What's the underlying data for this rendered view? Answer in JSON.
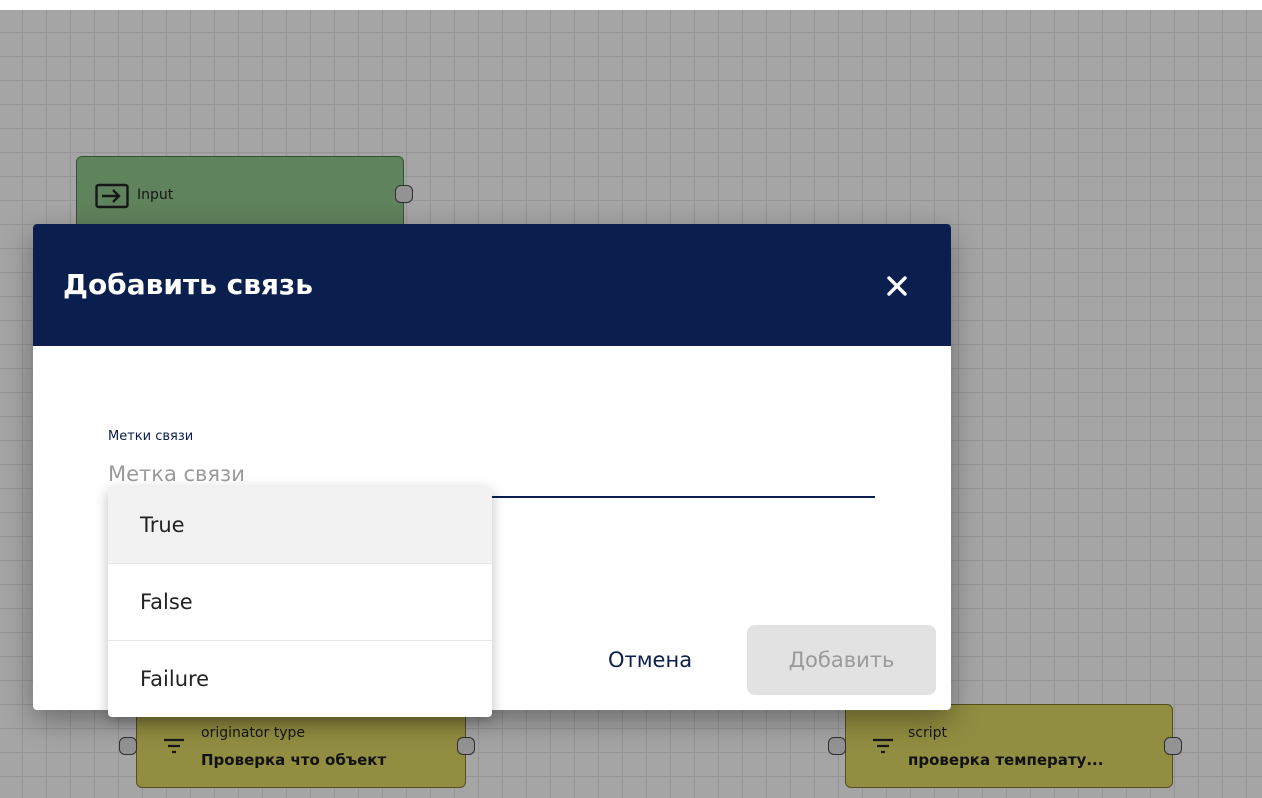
{
  "canvas": {
    "nodes": [
      {
        "id": "input",
        "title": "Input",
        "icon": "input-arrow-icon"
      },
      {
        "id": "originator",
        "type": "originator type",
        "name": "Проверка что объект",
        "icon": "filter-icon"
      },
      {
        "id": "script",
        "type": "script",
        "name": "проверка температу...",
        "icon": "filter-icon"
      }
    ]
  },
  "dialog": {
    "title": "Добавить связь",
    "close_icon": "close-icon",
    "field": {
      "label": "Метки связи",
      "placeholder": "Метка связи",
      "value": ""
    },
    "options": [
      "True",
      "False",
      "Failure"
    ],
    "selected_option": "True",
    "cancel_label": "Отмена",
    "add_label": "Добавить"
  },
  "colors": {
    "header": "#0a1f4e",
    "input_node": "#8cc18a",
    "filter_node": "#d6d061"
  }
}
